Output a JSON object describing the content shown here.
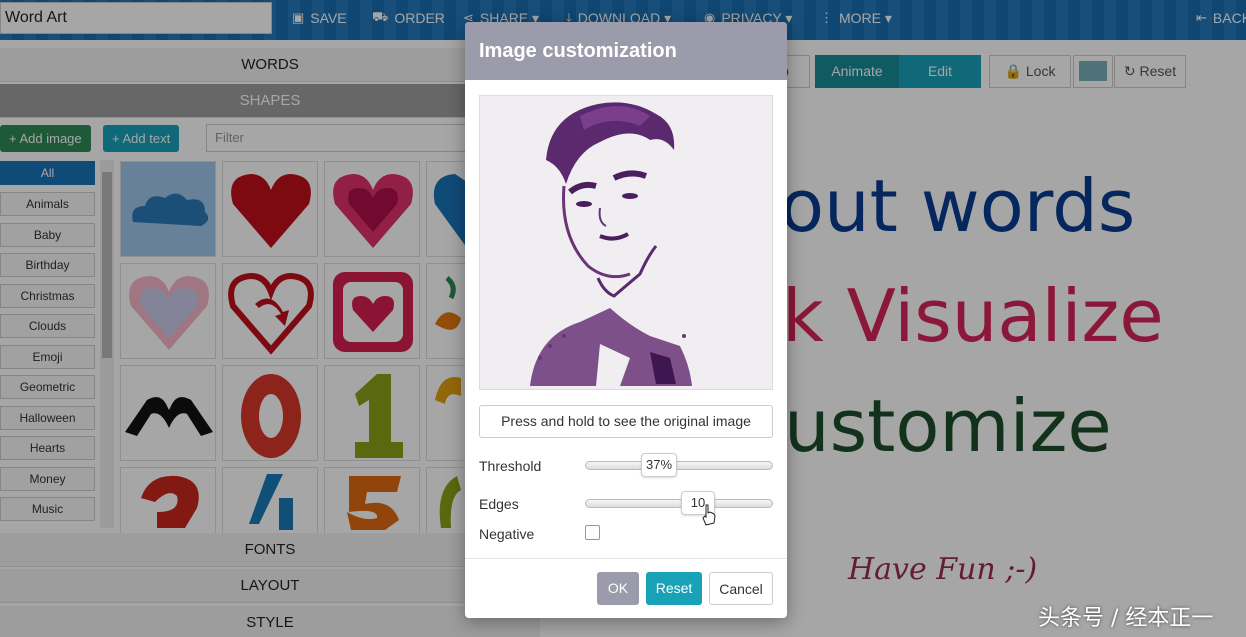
{
  "header": {
    "title_value": "Word Art",
    "nav": [
      {
        "label": "SAVE",
        "icon": "save-icon",
        "glyph": "💾"
      },
      {
        "label": "ORDER",
        "icon": "cart-icon",
        "glyph": "🛒"
      },
      {
        "label": "SHARE ▾",
        "icon": "share-icon",
        "glyph": "⋖"
      },
      {
        "label": "DOWNLOAD ▾",
        "icon": "download-icon",
        "glyph": "⤓"
      },
      {
        "label": "PRIVACY ▾",
        "icon": "eye-icon",
        "glyph": "👁"
      },
      {
        "label": "MORE ▾",
        "icon": "more-icon",
        "glyph": "⋮"
      }
    ],
    "back_label": "BACK",
    "back_icon": "back-icon"
  },
  "left_panel": {
    "sections": {
      "words": "WORDS",
      "shapes": "SHAPES",
      "fonts": "FONTS",
      "layout": "LAYOUT",
      "style": "STYLE"
    },
    "add_image": "+ Add image",
    "add_text": "+ Add text",
    "filter_placeholder": "Filter",
    "categories": [
      "All",
      "Animals",
      "Baby",
      "Birthday",
      "Christmas",
      "Clouds",
      "Emoji",
      "Geometric",
      "Halloween",
      "Hearts",
      "Money",
      "Music"
    ],
    "tiles": [
      "cloud",
      "heart-red",
      "heart-pink",
      "heart-blue",
      "heart-outline",
      "heart-arrow",
      "heart-square",
      "fruit",
      "hands-heart",
      "number-0",
      "number-1",
      "number-2",
      "number-3",
      "number-4",
      "number-5",
      "number-6"
    ]
  },
  "editor": {
    "buttons": {
      "animate": "Animate",
      "edit": "Edit",
      "lock": "Lock",
      "reset": "Reset",
      "partial_left": "o"
    },
    "canvas_lines": [
      "out words",
      "k Visualize",
      "ustomize"
    ],
    "have_fun": "Have Fun ;-)",
    "colors": {
      "blue": "#0a3d8f",
      "red": "#d6245a",
      "green": "#1e4d2b",
      "teal": "#2196a6"
    }
  },
  "modal": {
    "title": "Image customization",
    "press_button": "Press and hold to see the original image",
    "threshold_label": "Threshold",
    "threshold_value": "37%",
    "threshold_level": 0.37,
    "edges_label": "Edges",
    "edges_value": "10",
    "negative_label": "Negative",
    "negative_checked": false,
    "ok": "OK",
    "reset": "Reset",
    "cancel": "Cancel"
  },
  "watermark": "头条号 / 经本正一"
}
